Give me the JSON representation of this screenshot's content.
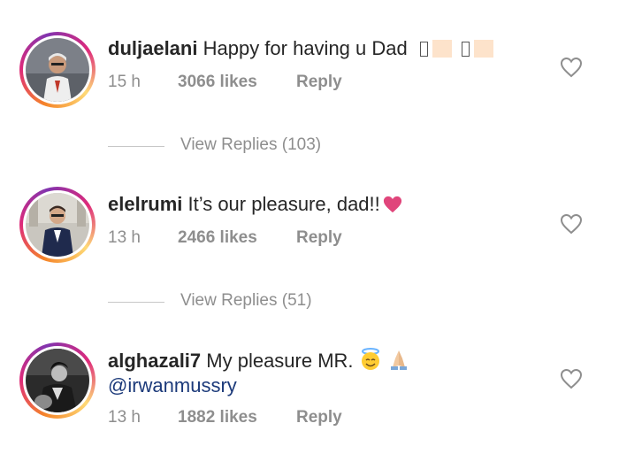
{
  "comments": [
    {
      "username": "duljaelani",
      "text": " Happy for having u Dad",
      "time": "15 h",
      "likes": "3066 likes",
      "reply": "Reply",
      "view_replies": "View Replies (103)"
    },
    {
      "username": "elelrumi",
      "text": " It’s our pleasure, dad!!",
      "time": "13 h",
      "likes": "2466 likes",
      "reply": "Reply",
      "view_replies": "View Replies (51)"
    },
    {
      "username": "alghazali7",
      "text": " My pleasure MR.",
      "mention": "@irwanmussry",
      "time": "13 h",
      "likes": "1882 likes",
      "reply": "Reply"
    }
  ],
  "icons": {
    "heart_outline": "heart-icon",
    "heart_red": "red-heart-emoji",
    "angel": "smiling-face-with-halo-emoji",
    "pray": "folded-hands-emoji"
  },
  "colors": {
    "username": "#262626",
    "meta": "#8e8e8e",
    "mention": "#1c3a7a",
    "ring_start": "#f58529",
    "ring_mid": "#dd2a7b",
    "ring_end": "#feda77",
    "red_heart": "#e0457b"
  }
}
